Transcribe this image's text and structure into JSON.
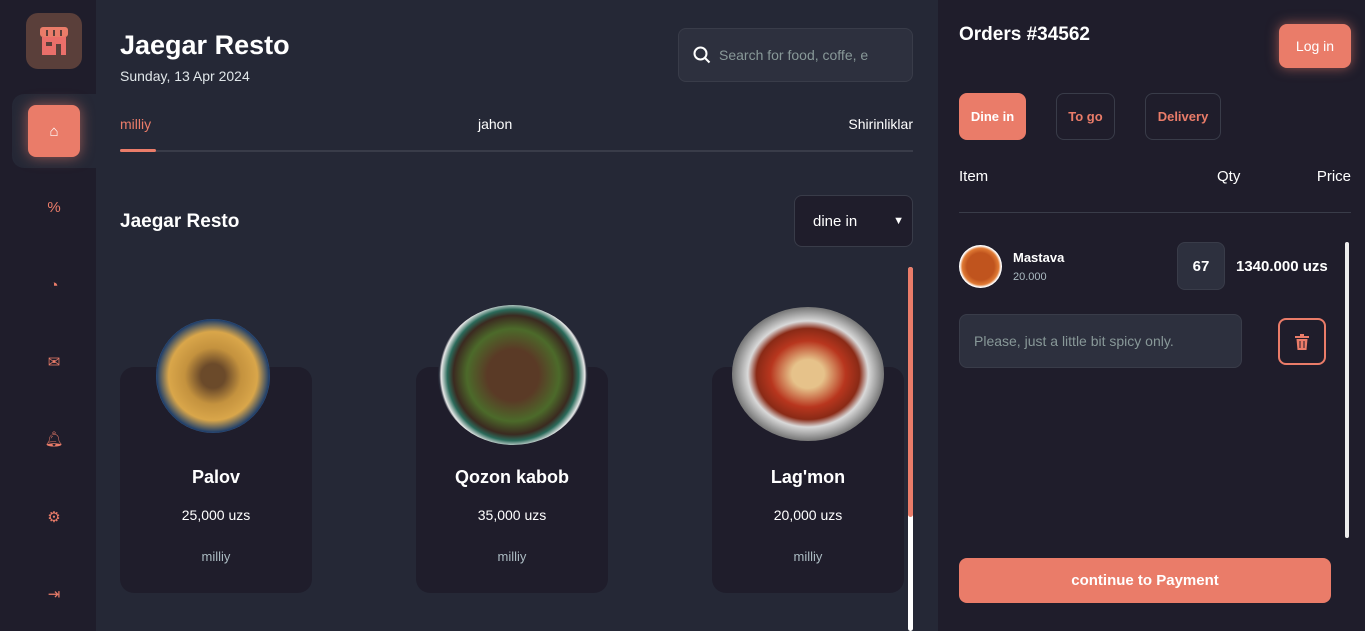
{
  "sidebar": {
    "items": [
      "home-icon",
      "discount-icon",
      "dashboard-icon",
      "message-icon",
      "notification-icon",
      "settings-icon",
      "logout-icon"
    ]
  },
  "header": {
    "title": "Jaegar Resto",
    "date": "Sunday, 13 Apr 2024",
    "search_placeholder": "Search for food, coffe, e"
  },
  "tabs": [
    {
      "label": "milliy"
    },
    {
      "label": "jahon"
    },
    {
      "label": "Shirinliklar"
    }
  ],
  "section": {
    "title": "Jaegar Resto",
    "select_value": "dine in"
  },
  "dishes": [
    {
      "name": "Palov",
      "price": "25,000 uzs",
      "category": "milliy"
    },
    {
      "name": "Qozon kabob",
      "price": "35,000 uzs",
      "category": "milliy"
    },
    {
      "name": "Lag'mon",
      "price": "20,000 uzs",
      "category": "milliy"
    }
  ],
  "order": {
    "title": "Orders #34562",
    "login": "Log in",
    "types": [
      "Dine in",
      "To go",
      "Delivery"
    ],
    "headers": {
      "item": "Item",
      "qty": "Qty",
      "price": "Price"
    },
    "items": [
      {
        "name": "Mastava",
        "unit_price": "20.000",
        "qty": "67",
        "total": "1340.000 uzs",
        "note": "Please, just a little bit spicy only."
      }
    ],
    "pay": "continue to Payment"
  },
  "colors": {
    "accent": "#ea7c69",
    "bg": "#252836",
    "panel": "#1f1d2b"
  }
}
